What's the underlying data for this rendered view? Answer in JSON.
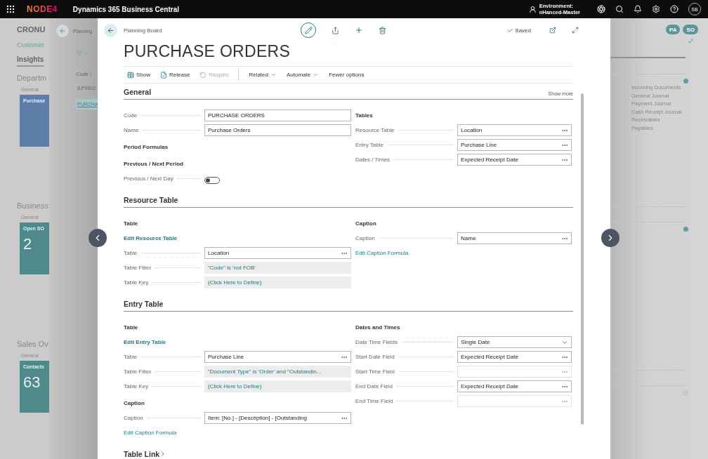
{
  "top_bar": {
    "logo": "NODE4",
    "product": "Dynamics 365 Business Central",
    "environment_label": "Environment:",
    "environment": "nHanced-Master",
    "avatar": "SB"
  },
  "role_center": {
    "company": "CRONU",
    "nav_link": "Customer",
    "tab": "Insights",
    "sections": [
      {
        "title": "Departm",
        "subtitle": "General",
        "tile": {
          "label": "Purchase",
          "color": "#5d7ea9"
        }
      },
      {
        "title": "Business",
        "subtitle": "General",
        "tile": {
          "label": "Open SO",
          "value": "2",
          "color": "#4f8a8b"
        }
      },
      {
        "title": "Sales Ov",
        "subtitle": "General",
        "tile": {
          "label": "Contacts",
          "value": "63",
          "color": "#4f8a8b"
        }
      }
    ],
    "badges": [
      "PA",
      "SO"
    ],
    "links": [
      "Incoming Documents",
      "General Journal",
      "Payment Journal",
      "Cash Receipt Journal",
      "Receivables",
      "Payables"
    ]
  },
  "list_page": {
    "title": "Planning",
    "column": "Code ↑",
    "rows": [
      {
        "code": "ILP0002",
        "selected": false
      },
      {
        "code": "PURCHA",
        "selected": true
      }
    ]
  },
  "dialog": {
    "breadcrumb": "Planning Board",
    "status": "Saved",
    "title": "PURCHASE ORDERS",
    "actions": [
      {
        "label": "Show",
        "kind": "button",
        "disabled": false
      },
      {
        "label": "Release",
        "kind": "button",
        "disabled": false
      },
      {
        "label": "Reopen",
        "kind": "button",
        "disabled": true
      },
      {
        "label": "Related",
        "kind": "menu",
        "disabled": false
      },
      {
        "label": "Automate",
        "kind": "menu",
        "disabled": false
      },
      {
        "label": "Fewer options",
        "kind": "plain",
        "disabled": false
      }
    ],
    "sections": [
      {
        "title": "General",
        "show_more": "Show more",
        "collapsed": false,
        "columns": [
          [
            {
              "kind": "text_field",
              "label": "Code",
              "value": "PURCHASE ORDERS",
              "disabled": false
            },
            {
              "kind": "text_field",
              "label": "Name",
              "value": "Purchase Orders",
              "disabled": false
            },
            {
              "kind": "group",
              "text": "Period Formulas"
            },
            {
              "kind": "group",
              "text": "Previous / Next Period"
            },
            {
              "kind": "toggle",
              "label": "Previous / Next Day",
              "on": false
            }
          ],
          [
            {
              "kind": "group",
              "text": "Tables"
            },
            {
              "kind": "lookup_field",
              "label": "Resource Table",
              "value": "Location",
              "disabled": false
            },
            {
              "kind": "lookup_field",
              "label": "Entry Table",
              "value": "Purchase Line",
              "disabled": false
            },
            {
              "kind": "lookup_field",
              "label": "Dates / Times",
              "value": "Expected Receipt Date",
              "disabled": false
            }
          ]
        ]
      },
      {
        "title": "Resource Table",
        "collapsed": false,
        "columns": [
          [
            {
              "kind": "group",
              "text": "Table"
            },
            {
              "kind": "action",
              "text": "Edit Resource Table"
            },
            {
              "kind": "lookup_field",
              "label": "Table",
              "value": "Location",
              "disabled": false
            },
            {
              "kind": "readonly_field",
              "label": "Table Filter",
              "value": "\"Code\" is 'not FOB'",
              "disabled": false
            },
            {
              "kind": "readonly_field",
              "label": "Table Key",
              "value": "(Click Here to Define)",
              "disabled": false
            }
          ],
          [
            {
              "kind": "group",
              "text": "Caption"
            },
            {
              "kind": "lookup_field",
              "label": "Caption",
              "value": "Name",
              "disabled": false
            },
            {
              "kind": "link",
              "text": "Edit Caption Formula"
            }
          ]
        ]
      },
      {
        "title": "Entry Table",
        "collapsed": false,
        "columns": [
          [
            {
              "kind": "group",
              "text": "Table"
            },
            {
              "kind": "action",
              "text": "Edit Entry Table"
            },
            {
              "kind": "lookup_field",
              "label": "Table",
              "value": "Purchase Line",
              "disabled": false
            },
            {
              "kind": "readonly_field",
              "label": "Table Filter",
              "value": "\"Document Type\" is 'Order' and \"Outstandin...",
              "disabled": false
            },
            {
              "kind": "readonly_field",
              "label": "Table Key",
              "value": "(Click Here to Define)",
              "disabled": false
            },
            {
              "kind": "group",
              "text": "Caption"
            },
            {
              "kind": "lookup_field",
              "label": "Caption",
              "value": "Item: [No.] - [Description] - [Outstanding",
              "disabled": false
            },
            {
              "kind": "link",
              "text": "Edit Caption Formula"
            }
          ],
          [
            {
              "kind": "group",
              "text": "Dates and Times"
            },
            {
              "kind": "select_field",
              "label": "Date Time Fields",
              "value": "Single Date",
              "disabled": false
            },
            {
              "kind": "lookup_field",
              "label": "Start Date Field",
              "value": "Expected Receipt Date",
              "disabled": false
            },
            {
              "kind": "lookup_field",
              "label": "Start Time Field",
              "disabled": true
            },
            {
              "kind": "lookup_field",
              "label": "End Date Field",
              "value": "Expected Receipt Date",
              "disabled": false
            },
            {
              "kind": "lookup_field",
              "label": "End Time Field",
              "disabled": true
            }
          ]
        ]
      },
      {
        "title": "Table Link",
        "collapsed": true
      }
    ]
  }
}
